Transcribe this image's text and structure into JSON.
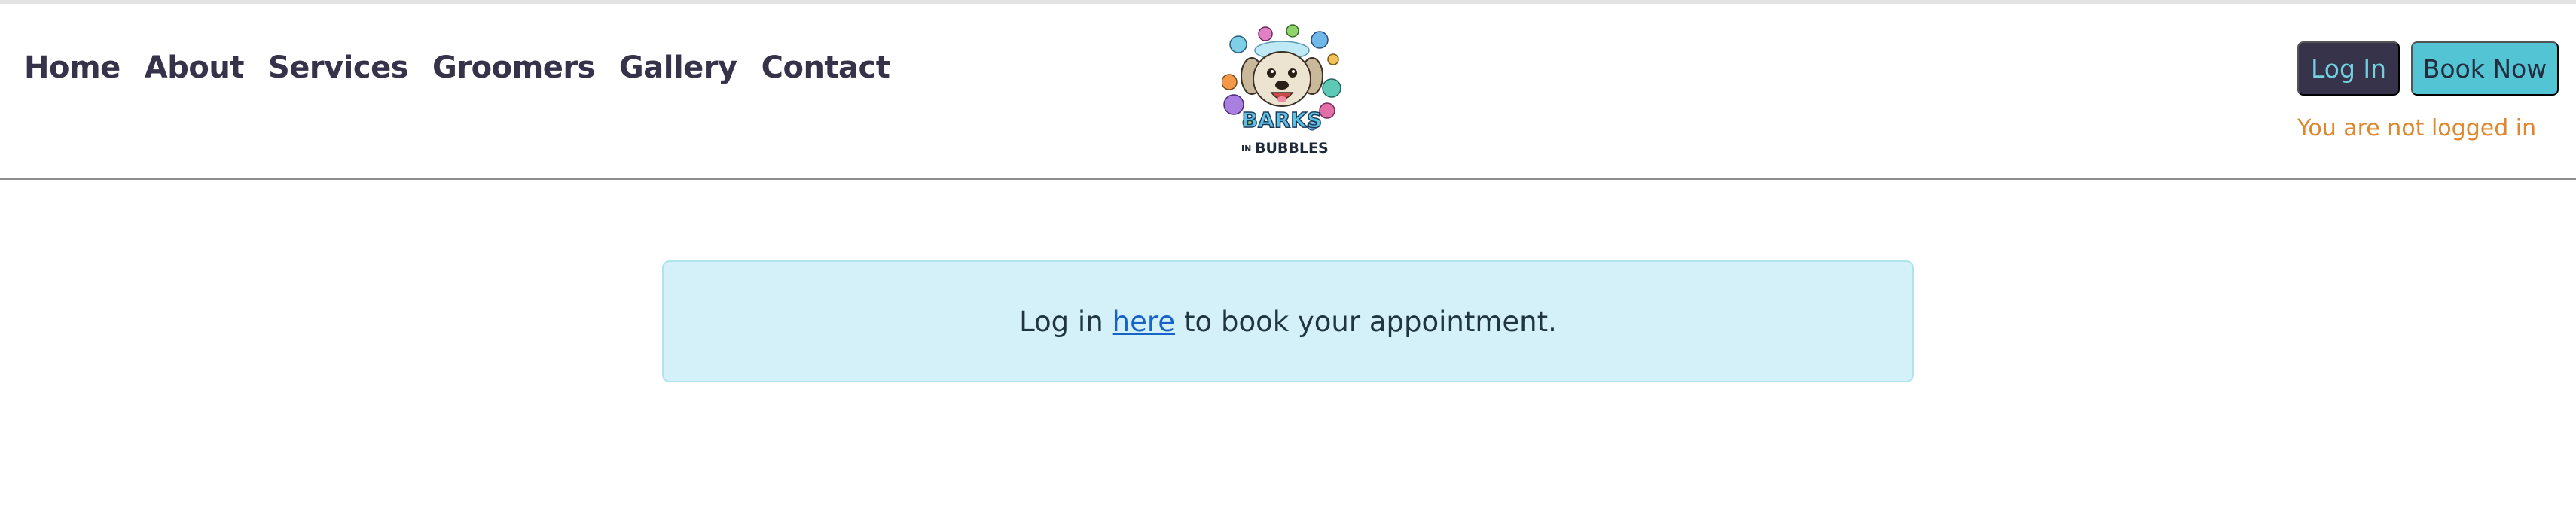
{
  "nav": {
    "items": [
      {
        "label": "Home"
      },
      {
        "label": "About"
      },
      {
        "label": "Services"
      },
      {
        "label": "Groomers"
      },
      {
        "label": "Gallery"
      },
      {
        "label": "Contact"
      }
    ]
  },
  "logo": {
    "line1": "BARKS",
    "line2_small": "IN",
    "line2": "BUBBLES"
  },
  "auth": {
    "login_label": "Log In",
    "book_label": "Book Now",
    "status": "You are not logged in"
  },
  "alert": {
    "pre": "Log in",
    "link": "here",
    "post": "to book your appointment."
  },
  "colors": {
    "nav_text": "#35324a",
    "login_bg": "#36334b",
    "book_bg": "#52c4d3",
    "status_text": "#e0872e",
    "alert_bg": "#d4f1f9",
    "link": "#1763c8"
  }
}
